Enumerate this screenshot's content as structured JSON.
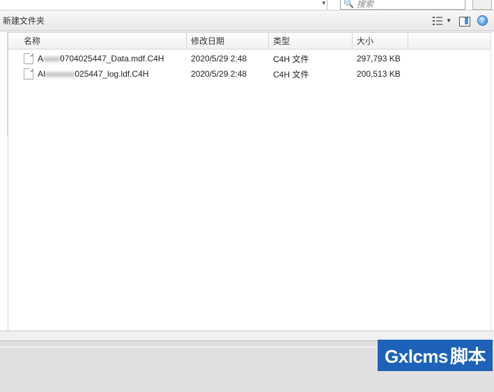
{
  "top": {
    "search_placeholder": "搜索"
  },
  "toolbar": {
    "new_folder_label": "新建文件夹"
  },
  "columns": {
    "name": "名称",
    "modified": "修改日期",
    "type": "类型",
    "size": "大小"
  },
  "file_type_label": "C4H 文件",
  "files": [
    {
      "name_prefix": "A",
      "name_obscured": "xxxx",
      "name_suffix": "0704025447_Data.mdf.C4H",
      "modified": "2020/5/29 2:48",
      "type_key": "C4H",
      "size": "297,793 KB"
    },
    {
      "name_prefix": "AI",
      "name_obscured": "xxxxxxx",
      "name_suffix": "025447_log.ldf.C4H",
      "modified": "2020/5/29 2:48",
      "type_key": "C4H",
      "size": "200,513 KB"
    }
  ],
  "watermark": {
    "brand_en": "Gxlcms",
    "brand_cn": "脚本"
  },
  "chart_data": {
    "type": "table",
    "columns": [
      "名称",
      "修改日期",
      "类型",
      "大小"
    ],
    "rows": [
      [
        "A…0704025447_Data.mdf.C4H",
        "2020/5/29 2:48",
        "C4H 文件",
        "297,793 KB"
      ],
      [
        "AI…025447_log.ldf.C4H",
        "2020/5/29 2:48",
        "C4H 文件",
        "200,513 KB"
      ]
    ],
    "title": "",
    "xlabel": "",
    "ylabel": ""
  }
}
